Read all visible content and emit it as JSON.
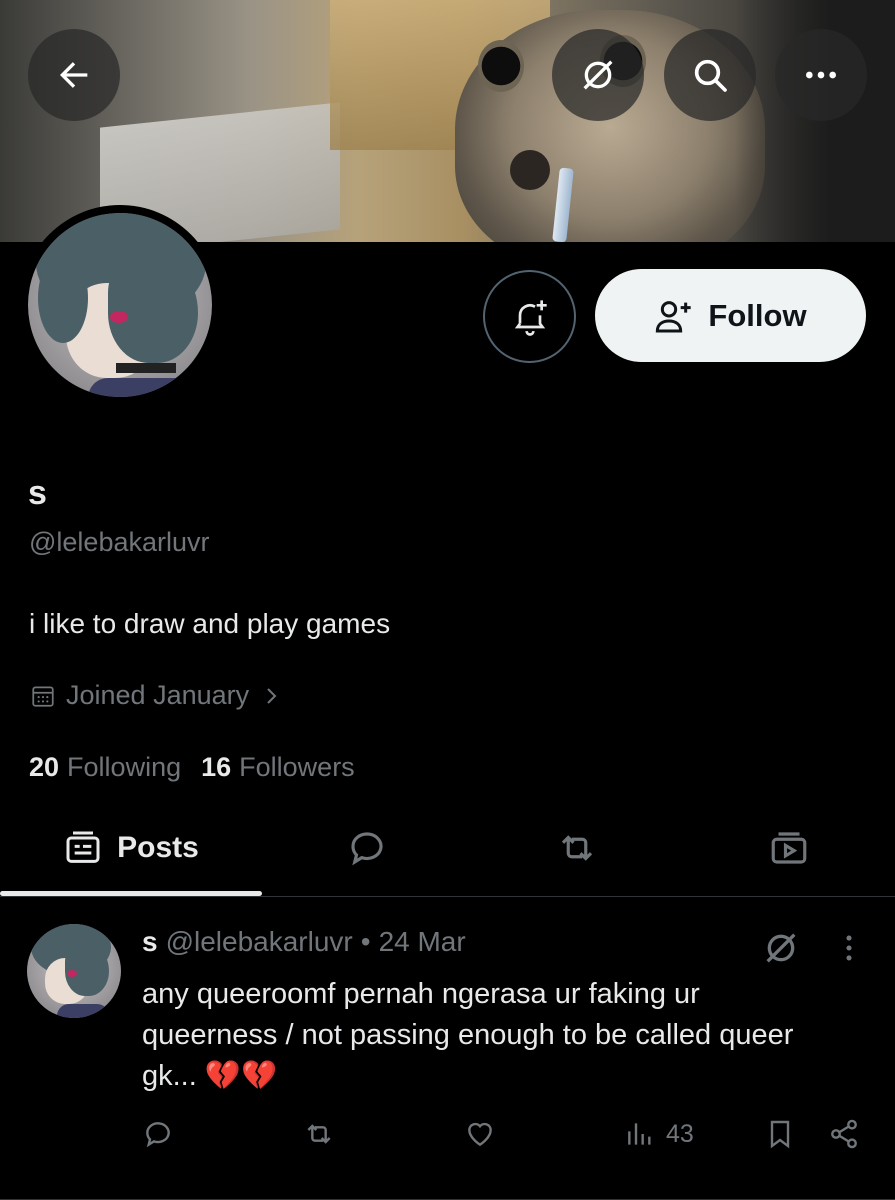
{
  "header": {
    "back_icon": "arrow-left-icon",
    "grok_icon": "slashed-circle-icon",
    "search_icon": "search-icon",
    "more_icon": "more-horizontal-icon"
  },
  "profile": {
    "display_name": "s",
    "handle": "@lelebakarluvr",
    "bio": "i like to draw and play games",
    "joined": "Joined January",
    "following_count": "20",
    "following_label": "Following",
    "followers_count": "16",
    "followers_label": "Followers",
    "follow_label": "Follow"
  },
  "tabs": [
    {
      "label": "Posts",
      "icon": "posts-icon",
      "active": true
    },
    {
      "label": "",
      "icon": "reply-icon"
    },
    {
      "label": "",
      "icon": "repost-icon"
    },
    {
      "label": "",
      "icon": "media-icon"
    }
  ],
  "post": {
    "name": "s",
    "handle": "@lelebakarluvr",
    "separator": "•",
    "date": "24 Mar",
    "text": "any queeroomf pernah ngerasa ur faking ur queerness / not passing enough to be called queer gk... 💔💔",
    "views": "43"
  },
  "colors": {
    "background": "#000000",
    "text_primary": "#e7e9ea",
    "text_secondary": "#71767b",
    "follow_bg": "#eff3f4",
    "border": "#2f3336"
  }
}
